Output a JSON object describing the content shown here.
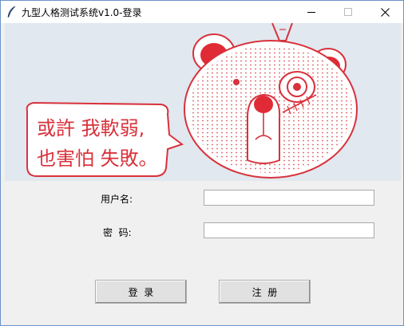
{
  "window": {
    "title": "九型人格测试系统v1.0-登录"
  },
  "banner": {
    "speech_line1": "或許 我軟弱,",
    "speech_line2": "也害怕 失敗。"
  },
  "form": {
    "username_label": "用户名:",
    "username_value": "",
    "password_label": "密  码:",
    "password_value": ""
  },
  "buttons": {
    "login_label": "登  录",
    "register_label": "注  册"
  },
  "icons": {
    "app": "feather-icon",
    "minimize": "minimize-icon",
    "maximize": "maximize-icon",
    "close": "close-icon"
  },
  "colors": {
    "illustration_red": "#d8323c",
    "banner_background": "#dde5ec"
  }
}
